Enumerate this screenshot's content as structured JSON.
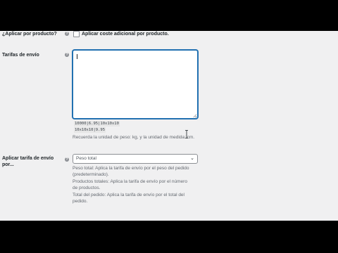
{
  "row_per_product": {
    "label": "¿Aplicar por producto?",
    "checkbox_label": "Aplicar coste adicional por producto.",
    "checked": false
  },
  "row_rates": {
    "label": "Tarifas de envío",
    "textarea_value": "",
    "examples": [
      "10000|6.95|10x10x10",
      "10x10x10|9.95"
    ],
    "help_text": "Recuerda la unidad de peso: kg, y la unidad de medida: cm."
  },
  "row_apply": {
    "label_line1": "Aplicar tarifa de envío",
    "label_line2": "por...",
    "selected": "Peso total",
    "desc_lines": [
      "Peso total: Aplica la tarifa de envío por el peso del pedido",
      "(predeterminado).",
      "Productos totales: Aplica la tarifa de envío por el número",
      "de productos.",
      "Total del pedido: Aplica la tarifa de envío por el total del",
      "pedido."
    ]
  },
  "icons": {
    "help": "question-circle-icon",
    "dropdown": "chevron-down-icon",
    "cursor": "text-cursor-icon"
  },
  "colors": {
    "background": "#f0f0f1",
    "focus": "#2271b1",
    "help_icon": "#8c8f94"
  }
}
